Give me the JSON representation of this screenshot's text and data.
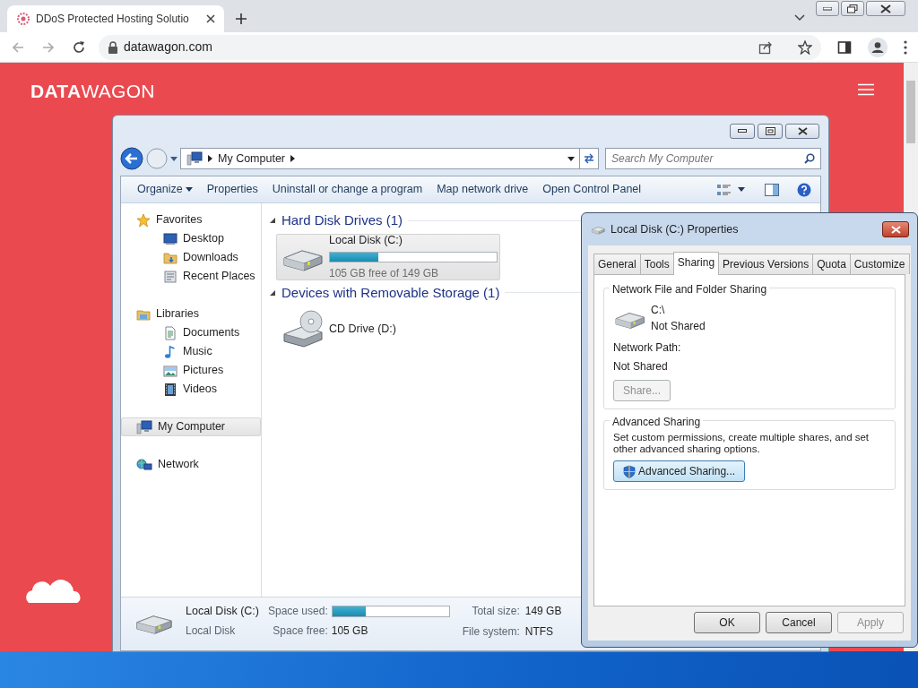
{
  "browser": {
    "tab": {
      "title": "DDoS Protected Hosting Solutio"
    },
    "url": "datawagon.com"
  },
  "site": {
    "logo_bold": "DATA",
    "logo_light": "WAGON"
  },
  "explorer": {
    "breadcrumb": "My Computer",
    "search": {
      "placeholder": "Search My Computer"
    },
    "toolbar": [
      {
        "label": "Organize",
        "dropdown": true
      },
      {
        "label": "Properties",
        "dropdown": false
      },
      {
        "label": "Uninstall or change a program",
        "dropdown": false
      },
      {
        "label": "Map network drive",
        "dropdown": false
      },
      {
        "label": "Open Control Panel",
        "dropdown": false
      }
    ],
    "nav": [
      {
        "label": "Favorites",
        "selected": false,
        "children": [
          {
            "label": "Desktop",
            "selected": false
          },
          {
            "label": "Downloads",
            "selected": false
          },
          {
            "label": "Recent Places",
            "selected": false
          }
        ]
      },
      {
        "label": "Libraries",
        "selected": false,
        "children": [
          {
            "label": "Documents",
            "selected": false
          },
          {
            "label": "Music",
            "selected": false
          },
          {
            "label": "Pictures",
            "selected": false
          },
          {
            "label": "Videos",
            "selected": false
          }
        ]
      },
      {
        "label": "My Computer",
        "selected": true
      },
      {
        "label": "Network",
        "selected": false
      }
    ],
    "groups": [
      {
        "title": "Hard Disk Drives (1)",
        "items": [
          {
            "kind": "disk",
            "name": "Local Disk (C:)",
            "level": 0.29,
            "free": "105 GB free of 149 GB",
            "selected": true
          }
        ]
      },
      {
        "title": "Devices with Removable Storage (1)",
        "items": [
          {
            "kind": "cd",
            "name": "CD Drive (D:)",
            "selected": false
          }
        ]
      }
    ],
    "details": {
      "name": "Local Disk (C:)",
      "type": "Local Disk",
      "used_label": "Space used:",
      "level": 0.29,
      "free_label": "Space free:",
      "free": "105 GB",
      "total_label": "Total size:",
      "total": "149 GB",
      "fs_label": "File system:",
      "fs": "NTFS"
    }
  },
  "dialog": {
    "title": "Local Disk (C:) Properties",
    "tabs": [
      {
        "label": "General",
        "selected": false
      },
      {
        "label": "Tools",
        "selected": false
      },
      {
        "label": "Sharing",
        "selected": true
      },
      {
        "label": "Previous Versions",
        "selected": false
      },
      {
        "label": "Quota",
        "selected": false
      },
      {
        "label": "Customize",
        "selected": false
      }
    ],
    "file_sharing": {
      "title": "Network File and Folder Sharing",
      "path": "C:\\",
      "status": "Not Shared",
      "network_path_label": "Network Path:",
      "network_path": "Not Shared",
      "button": {
        "label": "Share...",
        "disabled": true
      }
    },
    "advanced": {
      "title": "Advanced Sharing",
      "description": "Set custom permissions, create multiple shares, and set other advanced sharing options.",
      "button": {
        "label": "Advanced Sharing...",
        "disabled": false
      }
    },
    "buttons": [
      {
        "label": "OK",
        "disabled": false
      },
      {
        "label": "Cancel",
        "disabled": false
      },
      {
        "label": "Apply",
        "disabled": true
      }
    ]
  }
}
